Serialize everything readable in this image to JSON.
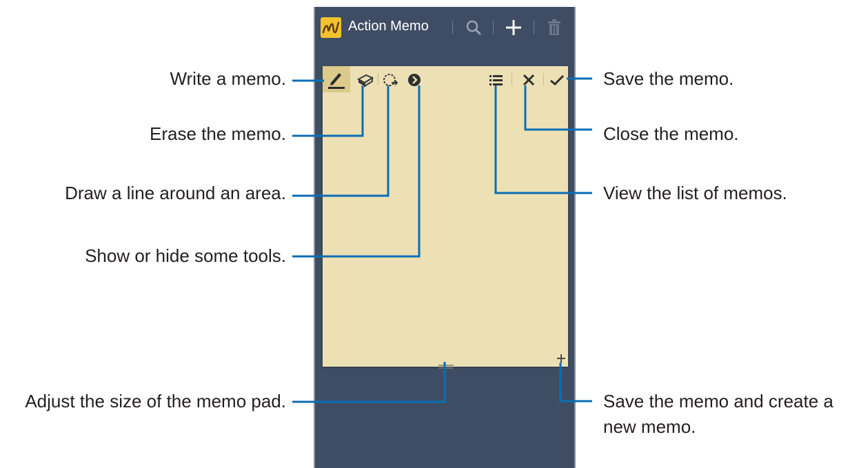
{
  "app": {
    "title": "Action Memo"
  },
  "action_bar": {
    "icons": [
      "action-memo-app-icon",
      "search-icon",
      "add-icon",
      "delete-icon"
    ]
  },
  "memo_toolbar": {
    "icons": [
      "pen-icon",
      "eraser-icon",
      "lasso-icon",
      "expand-tools-icon",
      "list-icon",
      "close-icon",
      "checkmark-icon"
    ]
  },
  "memo_pad": {
    "bottom_icons": [
      "resize-handle-icon",
      "corner-plus-icon"
    ]
  },
  "callouts": {
    "write": "Write a memo.",
    "erase": "Erase the memo.",
    "lasso": "Draw a line around an area.",
    "tools": "Show or hide some tools.",
    "adjust": "Adjust the size of the memo pad.",
    "save": "Save the memo.",
    "close": "Close the memo.",
    "list": "View the list of memos.",
    "save_new_line1": "Save the memo and create a",
    "save_new_line2": "new memo."
  },
  "colors": {
    "screen_bg": "#3f4d64",
    "memo_bg": "#ece0b4",
    "app_icon": "#f2c230",
    "leader": "#0a6eb5",
    "text": "#231f20"
  }
}
